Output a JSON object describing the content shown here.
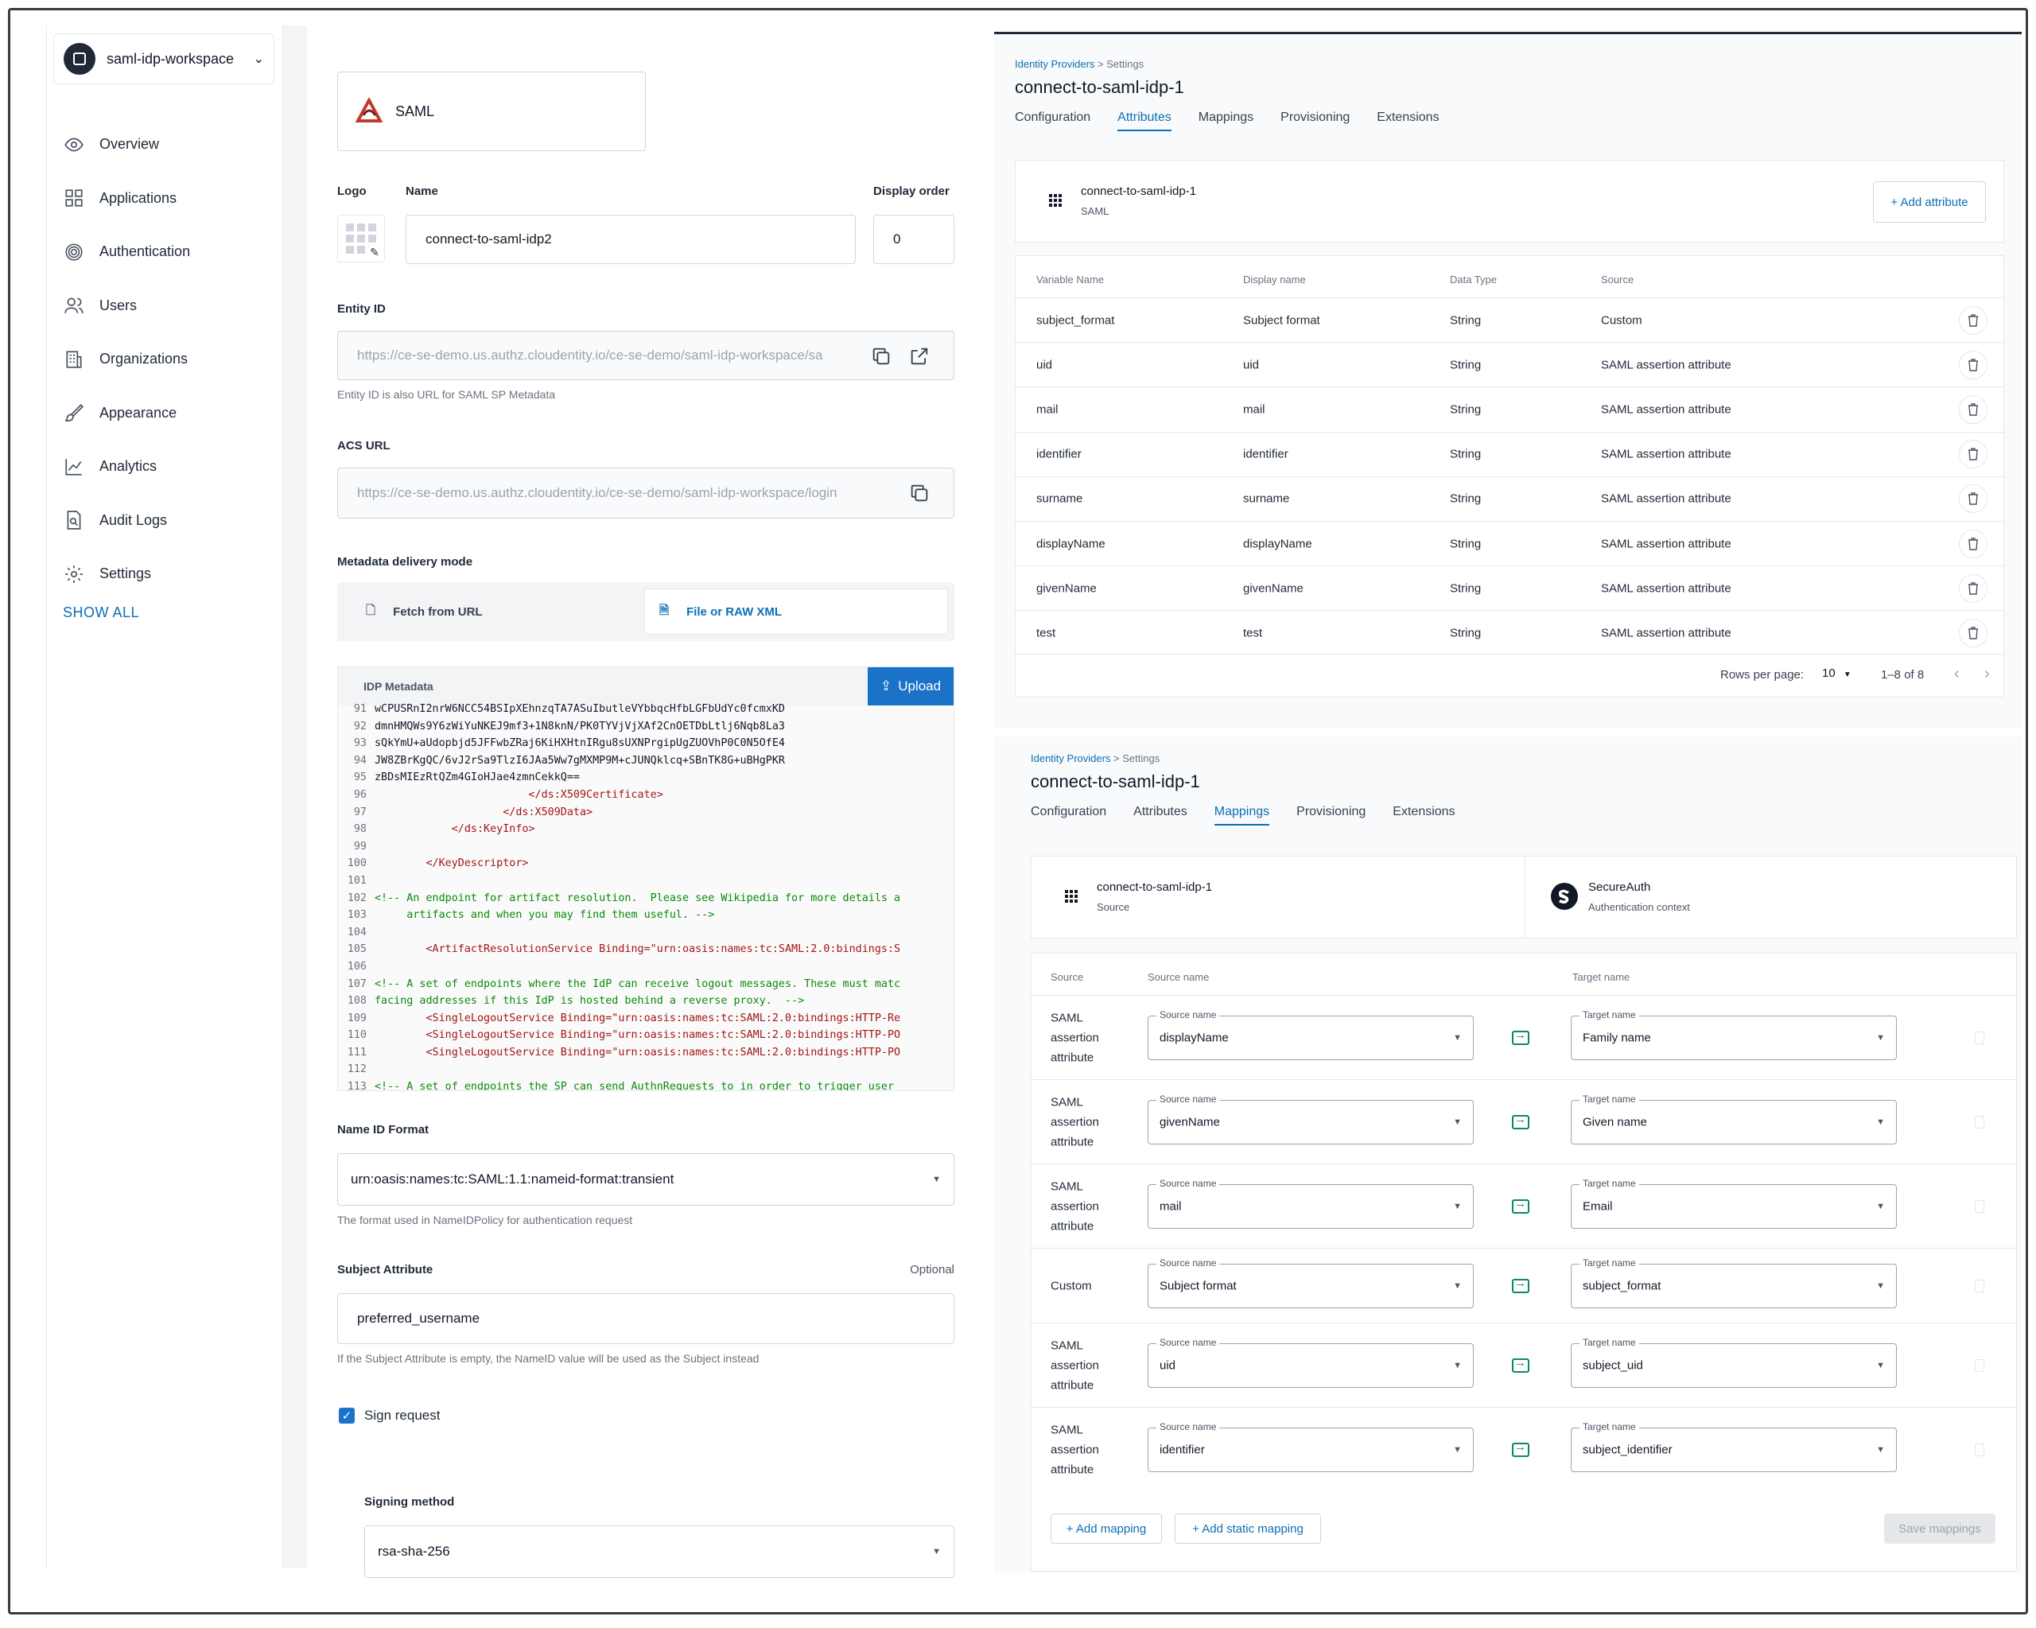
{
  "sidebar": {
    "workspace": "saml-idp-workspace",
    "items": [
      {
        "label": "Overview",
        "icon": "eye-icon"
      },
      {
        "label": "Applications",
        "icon": "grid-icon"
      },
      {
        "label": "Authentication",
        "icon": "fingerprint-icon"
      },
      {
        "label": "Users",
        "icon": "users-icon"
      },
      {
        "label": "Organizations",
        "icon": "building-icon"
      },
      {
        "label": "Appearance",
        "icon": "brush-icon"
      },
      {
        "label": "Analytics",
        "icon": "chart-icon"
      },
      {
        "label": "Audit Logs",
        "icon": "audit-log-icon"
      },
      {
        "label": "Settings",
        "icon": "gear-icon"
      }
    ],
    "show_all": "SHOW ALL"
  },
  "form": {
    "provider_type": "SAML",
    "logo_label": "Logo",
    "name_label": "Name",
    "name_value": "connect-to-saml-idp2",
    "display_order_label": "Display order",
    "display_order_value": "0",
    "entity_id_label": "Entity ID",
    "entity_id_value": "https://ce-se-demo.us.authz.cloudentity.io/ce-se-demo/saml-idp-workspace/sa",
    "entity_id_help": "Entity ID is also URL for SAML SP Metadata",
    "acs_label": "ACS URL",
    "acs_value": "https://ce-se-demo.us.authz.cloudentity.io/ce-se-demo/saml-idp-workspace/login",
    "metadata_mode_label": "Metadata delivery mode",
    "mode_fetch": "Fetch from URL",
    "mode_file": "File or RAW XML",
    "idp_metadata_label": "IDP Metadata",
    "upload_label": "Upload",
    "code_lines": [
      {
        "n": "91",
        "t": "wCPUSRnI2nrW6NCC54BSIpXEhnzqTA7ASuIbutleVYbbqcHfbLGFbUdYc0fcmxKD",
        "k": "ct"
      },
      {
        "n": "92",
        "t": "dmnHMQWs9Y6zWiYuNKEJ9mf3+1N8knN/PK0TYVjVjXAf2CnOETDbLtlj6Nqb8La3",
        "k": "ct"
      },
      {
        "n": "93",
        "t": "sQkYmU+aUdopbjd5JFFwbZRaj6KiHXHtnIRgu8sUXNPrgipUgZUOVhP0C0N5OfE4",
        "k": "ct"
      },
      {
        "n": "94",
        "t": "JW8ZBrKgQC/6vJ2rSa9TlzI6JAa5Ww7gMXMP9M+cJUNQklcq+SBnTK8G+uBHgPKR",
        "k": "ct"
      },
      {
        "n": "95",
        "t": "zBDsMIEzRtQZm4GIoHJae4zmnCekkQ==",
        "k": "ct"
      },
      {
        "n": "96",
        "t": "                        </ds:X509Certificate>",
        "k": "tag"
      },
      {
        "n": "97",
        "t": "                    </ds:X509Data>",
        "k": "tag"
      },
      {
        "n": "98",
        "t": "            </ds:KeyInfo>",
        "k": "tag"
      },
      {
        "n": "99",
        "t": "",
        "k": "ct"
      },
      {
        "n": "100",
        "t": "        </KeyDescriptor>",
        "k": "tag"
      },
      {
        "n": "101",
        "t": "",
        "k": "ct"
      },
      {
        "n": "102",
        "t": "<!-- An endpoint for artifact resolution.  Please see Wikipedia for more details a",
        "k": "cmt"
      },
      {
        "n": "103",
        "t": "     artifacts and when you may find them useful. -->",
        "k": "cmt"
      },
      {
        "n": "104",
        "t": "",
        "k": "ct"
      },
      {
        "n": "105",
        "t": "        <ArtifactResolutionService Binding=\"urn:oasis:names:tc:SAML:2.0:bindings:S",
        "k": "tag"
      },
      {
        "n": "106",
        "t": "",
        "k": "ct"
      },
      {
        "n": "107",
        "t": "<!-- A set of endpoints where the IdP can receive logout messages. These must matc",
        "k": "cmt"
      },
      {
        "n": "108",
        "t": "facing addresses if this IdP is hosted behind a reverse proxy.  -->",
        "k": "cmt"
      },
      {
        "n": "109",
        "t": "        <SingleLogoutService Binding=\"urn:oasis:names:tc:SAML:2.0:bindings:HTTP-Re",
        "k": "tag"
      },
      {
        "n": "110",
        "t": "        <SingleLogoutService Binding=\"urn:oasis:names:tc:SAML:2.0:bindings:HTTP-PO",
        "k": "tag"
      },
      {
        "n": "111",
        "t": "        <SingleLogoutService Binding=\"urn:oasis:names:tc:SAML:2.0:bindings:HTTP-PO",
        "k": "tag"
      },
      {
        "n": "112",
        "t": "",
        "k": "ct"
      },
      {
        "n": "113",
        "t": "<!-- A set of endpoints the SP can send AuthnRequests to in order to trigger user",
        "k": "cmt"
      }
    ],
    "name_id_label": "Name ID Format",
    "name_id_value": "urn:oasis:names:tc:SAML:1.1:nameid-format:transient",
    "name_id_help": "The format used in NameIDPolicy for authentication request",
    "subject_label": "Subject Attribute",
    "subject_optional": "Optional",
    "subject_value": "preferred_username",
    "subject_help": "If the Subject Attribute is empty, the NameID value will be used as the Subject instead",
    "sign_request_label": "Sign request",
    "signing_method_label": "Signing method",
    "signing_method_value": "rsa-sha-256"
  },
  "attributes_panel": {
    "crumb_link": "Identity Providers",
    "crumb_rest": " > Settings",
    "title": "connect-to-saml-idp-1",
    "tabs": [
      "Configuration",
      "Attributes",
      "Mappings",
      "Provisioning",
      "Extensions"
    ],
    "source_name": "connect-to-saml-idp-1",
    "source_type": "SAML",
    "add_attribute": "+ Add attribute",
    "headers": [
      "Variable Name",
      "Display name",
      "Data Type",
      "Source"
    ],
    "rows": [
      [
        "subject_format",
        "Subject format",
        "String",
        "Custom"
      ],
      [
        "uid",
        "uid",
        "String",
        "SAML assertion attribute"
      ],
      [
        "mail",
        "mail",
        "String",
        "SAML assertion attribute"
      ],
      [
        "identifier",
        "identifier",
        "String",
        "SAML assertion attribute"
      ],
      [
        "surname",
        "surname",
        "String",
        "SAML assertion attribute"
      ],
      [
        "displayName",
        "displayName",
        "String",
        "SAML assertion attribute"
      ],
      [
        "givenName",
        "givenName",
        "String",
        "SAML assertion attribute"
      ],
      [
        "test",
        "test",
        "String",
        "SAML assertion attribute"
      ]
    ],
    "rows_per_page_label": "Rows per page:",
    "rows_per_page_value": "10",
    "range": "1–8 of 8"
  },
  "mappings_panel": {
    "crumb_link": "Identity Providers",
    "crumb_rest": " > Settings",
    "title": "connect-to-saml-idp-1",
    "tabs": [
      "Configuration",
      "Attributes",
      "Mappings",
      "Provisioning",
      "Extensions"
    ],
    "source_name": "connect-to-saml-idp-1",
    "source_caption": "Source",
    "target_name": "SecureAuth",
    "target_caption": "Authentication context",
    "headers": [
      "Source",
      "Source name",
      "Target name"
    ],
    "field_source_label": "Source name",
    "field_target_label": "Target name",
    "rows": [
      {
        "source": "SAML assertion attribute",
        "source_name": "displayName",
        "target": "Family name"
      },
      {
        "source": "SAML assertion attribute",
        "source_name": "givenName",
        "target": "Given name"
      },
      {
        "source": "SAML assertion attribute",
        "source_name": "mail",
        "target": "Email"
      },
      {
        "source": "Custom",
        "source_name": "Subject format",
        "target": "subject_format"
      },
      {
        "source": "SAML assertion attribute",
        "source_name": "uid",
        "target": "subject_uid"
      },
      {
        "source": "SAML assertion attribute",
        "source_name": "identifier",
        "target": "subject_identifier"
      }
    ],
    "add_mapping": "+ Add mapping",
    "add_static_mapping": "+ Add static mapping",
    "save_mappings": "Save mappings"
  },
  "colors": {
    "accent": "#0b6fb3",
    "primary_button": "#1a73c8",
    "mapping_icon": "#0a8a5a"
  }
}
